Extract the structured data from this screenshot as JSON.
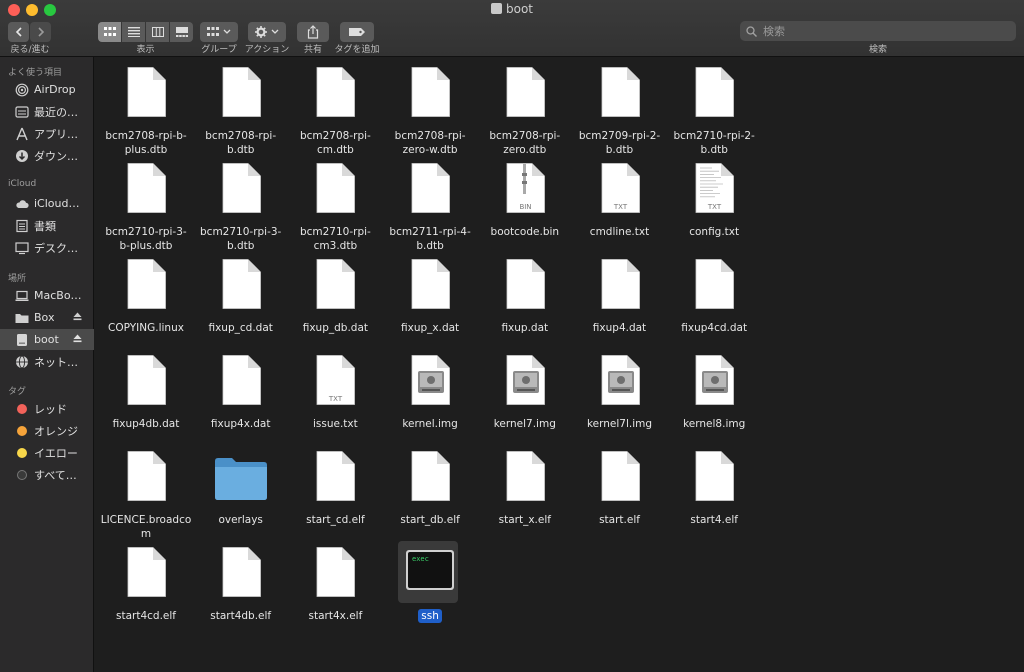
{
  "window": {
    "title": "boot"
  },
  "toolbar": {
    "nav_label": "戻る/進む",
    "view_label": "表示",
    "group_label": "グループ",
    "action_label": "アクション",
    "share_label": "共有",
    "tag_label": "タグを追加",
    "search_label": "検索",
    "search_placeholder": "検索"
  },
  "sidebar": {
    "favorites_header": "よく使う項目",
    "favorites": [
      {
        "label": "AirDrop",
        "icon": "airdrop-icon"
      },
      {
        "label": "最近の…",
        "icon": "recents-icon"
      },
      {
        "label": "アプリ…",
        "icon": "applications-icon"
      },
      {
        "label": "ダウン…",
        "icon": "downloads-icon"
      }
    ],
    "icloud_header": "iCloud",
    "icloud": [
      {
        "label": "iCloud…",
        "icon": "cloud-icon"
      },
      {
        "label": "書類",
        "icon": "document-icon"
      },
      {
        "label": "デスク…",
        "icon": "desktop-icon"
      }
    ],
    "locations_header": "場所",
    "locations": [
      {
        "label": "MacBo…",
        "icon": "laptop-icon"
      },
      {
        "label": "Box",
        "icon": "folder-icon"
      },
      {
        "label": "boot",
        "icon": "drive-icon"
      },
      {
        "label": "ネット…",
        "icon": "network-icon"
      }
    ],
    "tags_header": "タグ",
    "tags": [
      {
        "label": "レッド",
        "color": "#f2625a"
      },
      {
        "label": "オレンジ",
        "color": "#f5a33a"
      },
      {
        "label": "イエロー",
        "color": "#f8d74a"
      },
      {
        "label": "すべて…",
        "color": "#3a3a3a"
      }
    ]
  },
  "files": [
    {
      "name": "bcm2708-rpi-b-plus.dtb",
      "lines": [
        "bcm2708-rpi-b-",
        "plus.dtb"
      ],
      "kind": "doc"
    },
    {
      "name": "bcm2708-rpi-b.dtb",
      "lines": [
        "bcm2708-rpi-",
        "b.dtb"
      ],
      "kind": "doc"
    },
    {
      "name": "bcm2708-rpi-cm.dtb",
      "lines": [
        "bcm2708-rpi-",
        "cm.dtb"
      ],
      "kind": "doc"
    },
    {
      "name": "bcm2708-rpi-zero-w.dtb",
      "lines": [
        "bcm2708-rpi-",
        "zero-w.dtb"
      ],
      "kind": "doc"
    },
    {
      "name": "bcm2708-rpi-zero.dtb",
      "lines": [
        "bcm2708-rpi-",
        "zero.dtb"
      ],
      "kind": "doc"
    },
    {
      "name": "bcm2709-rpi-2-b.dtb",
      "lines": [
        "bcm2709-rpi-2-",
        "b.dtb"
      ],
      "kind": "doc"
    },
    {
      "name": "bcm2710-rpi-2-b.dtb",
      "lines": [
        "bcm2710-rpi-2-",
        "b.dtb"
      ],
      "kind": "doc"
    },
    {
      "name": "bcm2710-rpi-3-b-plus.dtb",
      "lines": [
        "bcm2710-rpi-3-",
        "b-plus.dtb"
      ],
      "kind": "doc"
    },
    {
      "name": "bcm2710-rpi-3-b.dtb",
      "lines": [
        "bcm2710-rpi-3-",
        "b.dtb"
      ],
      "kind": "doc"
    },
    {
      "name": "bcm2710-rpi-cm3.dtb",
      "lines": [
        "bcm2710-rpi-",
        "cm3.dtb"
      ],
      "kind": "doc"
    },
    {
      "name": "bcm2711-rpi-4-b.dtb",
      "lines": [
        "bcm2711-rpi-4-",
        "b.dtb"
      ],
      "kind": "doc"
    },
    {
      "name": "bootcode.bin",
      "lines": [
        "bootcode.bin"
      ],
      "kind": "bin",
      "badge": "BIN"
    },
    {
      "name": "cmdline.txt",
      "lines": [
        "cmdline.txt"
      ],
      "kind": "txt",
      "badge": "TXT"
    },
    {
      "name": "config.txt",
      "lines": [
        "config.txt"
      ],
      "kind": "txtlines",
      "badge": "TXT"
    },
    {
      "name": "COPYING.linux",
      "lines": [
        "COPYING.linux"
      ],
      "kind": "doc"
    },
    {
      "name": "fixup_cd.dat",
      "lines": [
        "fixup_cd.dat"
      ],
      "kind": "doc"
    },
    {
      "name": "fixup_db.dat",
      "lines": [
        "fixup_db.dat"
      ],
      "kind": "doc"
    },
    {
      "name": "fixup_x.dat",
      "lines": [
        "fixup_x.dat"
      ],
      "kind": "doc"
    },
    {
      "name": "fixup.dat",
      "lines": [
        "fixup.dat"
      ],
      "kind": "doc"
    },
    {
      "name": "fixup4.dat",
      "lines": [
        "fixup4.dat"
      ],
      "kind": "doc"
    },
    {
      "name": "fixup4cd.dat",
      "lines": [
        "fixup4cd.dat"
      ],
      "kind": "doc"
    },
    {
      "name": "fixup4db.dat",
      "lines": [
        "fixup4db.dat"
      ],
      "kind": "doc"
    },
    {
      "name": "fixup4x.dat",
      "lines": [
        "fixup4x.dat"
      ],
      "kind": "doc"
    },
    {
      "name": "issue.txt",
      "lines": [
        "issue.txt"
      ],
      "kind": "txt",
      "badge": "TXT"
    },
    {
      "name": "kernel.img",
      "lines": [
        "kernel.img"
      ],
      "kind": "img"
    },
    {
      "name": "kernel7.img",
      "lines": [
        "kernel7.img"
      ],
      "kind": "img"
    },
    {
      "name": "kernel7l.img",
      "lines": [
        "kernel7l.img"
      ],
      "kind": "img"
    },
    {
      "name": "kernel8.img",
      "lines": [
        "kernel8.img"
      ],
      "kind": "img"
    },
    {
      "name": "LICENCE.broadcom",
      "lines": [
        "LICENCE.broadco",
        "m"
      ],
      "kind": "doc"
    },
    {
      "name": "overlays",
      "lines": [
        "overlays"
      ],
      "kind": "folder"
    },
    {
      "name": "start_cd.elf",
      "lines": [
        "start_cd.elf"
      ],
      "kind": "doc"
    },
    {
      "name": "start_db.elf",
      "lines": [
        "start_db.elf"
      ],
      "kind": "doc"
    },
    {
      "name": "start_x.elf",
      "lines": [
        "start_x.elf"
      ],
      "kind": "doc"
    },
    {
      "name": "start.elf",
      "lines": [
        "start.elf"
      ],
      "kind": "doc"
    },
    {
      "name": "start4.elf",
      "lines": [
        "start4.elf"
      ],
      "kind": "doc"
    },
    {
      "name": "start4cd.elf",
      "lines": [
        "start4cd.elf"
      ],
      "kind": "doc"
    },
    {
      "name": "start4db.elf",
      "lines": [
        "start4db.elf"
      ],
      "kind": "doc"
    },
    {
      "name": "start4x.elf",
      "lines": [
        "start4x.elf"
      ],
      "kind": "doc"
    },
    {
      "name": "ssh",
      "lines": [
        "ssh"
      ],
      "kind": "exec",
      "badge": "exec",
      "selected": true
    }
  ]
}
